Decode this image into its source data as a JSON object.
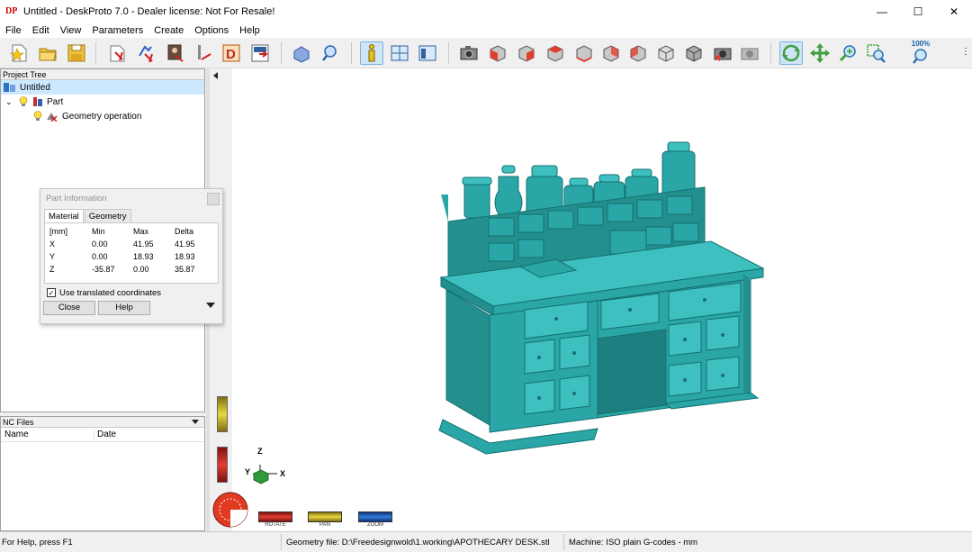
{
  "window": {
    "title": "Untitled - DeskProto 7.0 - Dealer license: Not For Resale!",
    "app_icon_text": "DP",
    "minimize_glyph": "—",
    "maximize_glyph": "☐",
    "close_glyph": "✕"
  },
  "menu": [
    "File",
    "Edit",
    "View",
    "Parameters",
    "Create",
    "Options",
    "Help"
  ],
  "toolbar": {
    "zoom_percent_label": "100%",
    "icons": [
      "new-file-icon",
      "open-folder-icon",
      "save-icon",
      "import-geometry-icon",
      "import-vector-icon",
      "import-bitmap-icon",
      "toolpath-icon",
      "dxf-icon",
      "export-icon",
      "cube-view-icon",
      "search-icon",
      "part-info-icon",
      "layout-icon",
      "window-icon",
      "camera-icon",
      "view-cube-1-icon",
      "view-cube-2-icon",
      "view-cube-3-icon",
      "view-cube-4-icon",
      "view-cube-5-icon",
      "view-cube-6-icon",
      "view-iso-icon",
      "view-iso2-icon",
      "screenshot-icon",
      "screenshot2-icon",
      "rotate-tool-icon",
      "pan-tool-icon",
      "zoom-tool-icon",
      "zoom-window-icon",
      "zoom-100-icon"
    ]
  },
  "project_tree": {
    "header": "Project Tree",
    "items": [
      {
        "label": "Untitled",
        "level": 0
      },
      {
        "label": "Part",
        "level": 1
      },
      {
        "label": "Geometry operation",
        "level": 2
      }
    ]
  },
  "nc_files": {
    "header": "NC Files",
    "columns": [
      "Name",
      "Date"
    ]
  },
  "part_info": {
    "title": "Part Information",
    "tabs": [
      "Material",
      "Geometry"
    ],
    "headers": [
      "[mm]",
      "Min",
      "Max",
      "Delta"
    ],
    "rows": [
      {
        "axis": "X",
        "min": "0.00",
        "max": "41.95",
        "delta": "41.95"
      },
      {
        "axis": "Y",
        "min": "0.00",
        "max": "18.93",
        "delta": "18.93"
      },
      {
        "axis": "Z",
        "min": "-35.87",
        "max": "0.00",
        "delta": "35.87"
      }
    ],
    "checkbox_label": "Use translated coordinates",
    "checkbox_checked": true,
    "close_label": "Close",
    "help_label": "Help"
  },
  "viewport": {
    "model_color": "#2aa6a6",
    "axes": {
      "x": "X",
      "y": "Y",
      "z": "Z"
    },
    "mode_buttons": [
      {
        "label": "ROTATE",
        "color": "#e03020"
      },
      {
        "label": "PAN",
        "color": "#d8d820"
      },
      {
        "label": "ZOOM",
        "color": "#3080d8"
      }
    ]
  },
  "status": {
    "help": "For Help, press F1",
    "geometry": "Geometry file: D:\\Freedesignwold\\1.working\\APOTHECARY DESK.stl",
    "machine": "Machine: ISO plain G-codes - mm"
  }
}
